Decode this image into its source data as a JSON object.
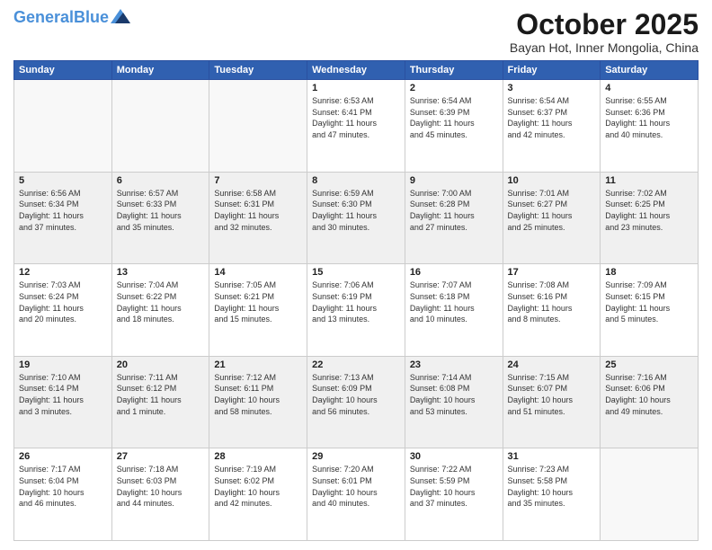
{
  "header": {
    "logo_line1": "General",
    "logo_line2": "Blue",
    "main_title": "October 2025",
    "subtitle": "Bayan Hot, Inner Mongolia, China"
  },
  "days_of_week": [
    "Sunday",
    "Monday",
    "Tuesday",
    "Wednesday",
    "Thursday",
    "Friday",
    "Saturday"
  ],
  "weeks": [
    [
      {
        "day": "",
        "info": ""
      },
      {
        "day": "",
        "info": ""
      },
      {
        "day": "",
        "info": ""
      },
      {
        "day": "1",
        "info": "Sunrise: 6:53 AM\nSunset: 6:41 PM\nDaylight: 11 hours\nand 47 minutes."
      },
      {
        "day": "2",
        "info": "Sunrise: 6:54 AM\nSunset: 6:39 PM\nDaylight: 11 hours\nand 45 minutes."
      },
      {
        "day": "3",
        "info": "Sunrise: 6:54 AM\nSunset: 6:37 PM\nDaylight: 11 hours\nand 42 minutes."
      },
      {
        "day": "4",
        "info": "Sunrise: 6:55 AM\nSunset: 6:36 PM\nDaylight: 11 hours\nand 40 minutes."
      }
    ],
    [
      {
        "day": "5",
        "info": "Sunrise: 6:56 AM\nSunset: 6:34 PM\nDaylight: 11 hours\nand 37 minutes."
      },
      {
        "day": "6",
        "info": "Sunrise: 6:57 AM\nSunset: 6:33 PM\nDaylight: 11 hours\nand 35 minutes."
      },
      {
        "day": "7",
        "info": "Sunrise: 6:58 AM\nSunset: 6:31 PM\nDaylight: 11 hours\nand 32 minutes."
      },
      {
        "day": "8",
        "info": "Sunrise: 6:59 AM\nSunset: 6:30 PM\nDaylight: 11 hours\nand 30 minutes."
      },
      {
        "day": "9",
        "info": "Sunrise: 7:00 AM\nSunset: 6:28 PM\nDaylight: 11 hours\nand 27 minutes."
      },
      {
        "day": "10",
        "info": "Sunrise: 7:01 AM\nSunset: 6:27 PM\nDaylight: 11 hours\nand 25 minutes."
      },
      {
        "day": "11",
        "info": "Sunrise: 7:02 AM\nSunset: 6:25 PM\nDaylight: 11 hours\nand 23 minutes."
      }
    ],
    [
      {
        "day": "12",
        "info": "Sunrise: 7:03 AM\nSunset: 6:24 PM\nDaylight: 11 hours\nand 20 minutes."
      },
      {
        "day": "13",
        "info": "Sunrise: 7:04 AM\nSunset: 6:22 PM\nDaylight: 11 hours\nand 18 minutes."
      },
      {
        "day": "14",
        "info": "Sunrise: 7:05 AM\nSunset: 6:21 PM\nDaylight: 11 hours\nand 15 minutes."
      },
      {
        "day": "15",
        "info": "Sunrise: 7:06 AM\nSunset: 6:19 PM\nDaylight: 11 hours\nand 13 minutes."
      },
      {
        "day": "16",
        "info": "Sunrise: 7:07 AM\nSunset: 6:18 PM\nDaylight: 11 hours\nand 10 minutes."
      },
      {
        "day": "17",
        "info": "Sunrise: 7:08 AM\nSunset: 6:16 PM\nDaylight: 11 hours\nand 8 minutes."
      },
      {
        "day": "18",
        "info": "Sunrise: 7:09 AM\nSunset: 6:15 PM\nDaylight: 11 hours\nand 5 minutes."
      }
    ],
    [
      {
        "day": "19",
        "info": "Sunrise: 7:10 AM\nSunset: 6:14 PM\nDaylight: 11 hours\nand 3 minutes."
      },
      {
        "day": "20",
        "info": "Sunrise: 7:11 AM\nSunset: 6:12 PM\nDaylight: 11 hours\nand 1 minute."
      },
      {
        "day": "21",
        "info": "Sunrise: 7:12 AM\nSunset: 6:11 PM\nDaylight: 10 hours\nand 58 minutes."
      },
      {
        "day": "22",
        "info": "Sunrise: 7:13 AM\nSunset: 6:09 PM\nDaylight: 10 hours\nand 56 minutes."
      },
      {
        "day": "23",
        "info": "Sunrise: 7:14 AM\nSunset: 6:08 PM\nDaylight: 10 hours\nand 53 minutes."
      },
      {
        "day": "24",
        "info": "Sunrise: 7:15 AM\nSunset: 6:07 PM\nDaylight: 10 hours\nand 51 minutes."
      },
      {
        "day": "25",
        "info": "Sunrise: 7:16 AM\nSunset: 6:06 PM\nDaylight: 10 hours\nand 49 minutes."
      }
    ],
    [
      {
        "day": "26",
        "info": "Sunrise: 7:17 AM\nSunset: 6:04 PM\nDaylight: 10 hours\nand 46 minutes."
      },
      {
        "day": "27",
        "info": "Sunrise: 7:18 AM\nSunset: 6:03 PM\nDaylight: 10 hours\nand 44 minutes."
      },
      {
        "day": "28",
        "info": "Sunrise: 7:19 AM\nSunset: 6:02 PM\nDaylight: 10 hours\nand 42 minutes."
      },
      {
        "day": "29",
        "info": "Sunrise: 7:20 AM\nSunset: 6:01 PM\nDaylight: 10 hours\nand 40 minutes."
      },
      {
        "day": "30",
        "info": "Sunrise: 7:22 AM\nSunset: 5:59 PM\nDaylight: 10 hours\nand 37 minutes."
      },
      {
        "day": "31",
        "info": "Sunrise: 7:23 AM\nSunset: 5:58 PM\nDaylight: 10 hours\nand 35 minutes."
      },
      {
        "day": "",
        "info": ""
      }
    ]
  ]
}
